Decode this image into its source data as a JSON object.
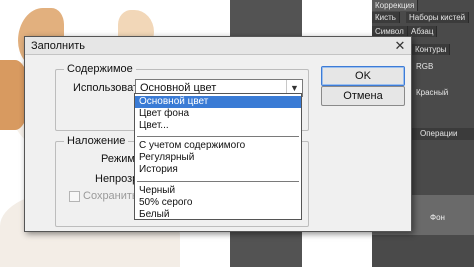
{
  "panels": {
    "top_tabs": [
      "Коррекция",
      "Кисть",
      "Наборы кистей",
      "Символ",
      "Абзац",
      "Контуры"
    ],
    "channels": [
      {
        "label": "RGB"
      },
      {
        "label": "Красный"
      }
    ],
    "ops_tab": "Операции",
    "layer_label": "Фон"
  },
  "dialog": {
    "title": "Заполнить",
    "close_label": "✕",
    "contents": {
      "legend": "Содержимое",
      "use_label": "Использовать:",
      "use_value": "Основной цвет"
    },
    "blending": {
      "legend": "Наложение",
      "mode_label": "Режим:",
      "opacity_label": "Непрозр.:",
      "preserve_label": "Сохранить пр"
    },
    "buttons": {
      "ok": "OK",
      "cancel": "Отмена"
    },
    "dropdown_groups": [
      [
        "Основной цвет",
        "Цвет фона",
        "Цвет..."
      ],
      [
        "С учетом содержимого",
        "Регулярный",
        "История"
      ],
      [
        "Черный",
        "50% серого",
        "Белый"
      ]
    ],
    "selected_option": "Основной цвет"
  }
}
